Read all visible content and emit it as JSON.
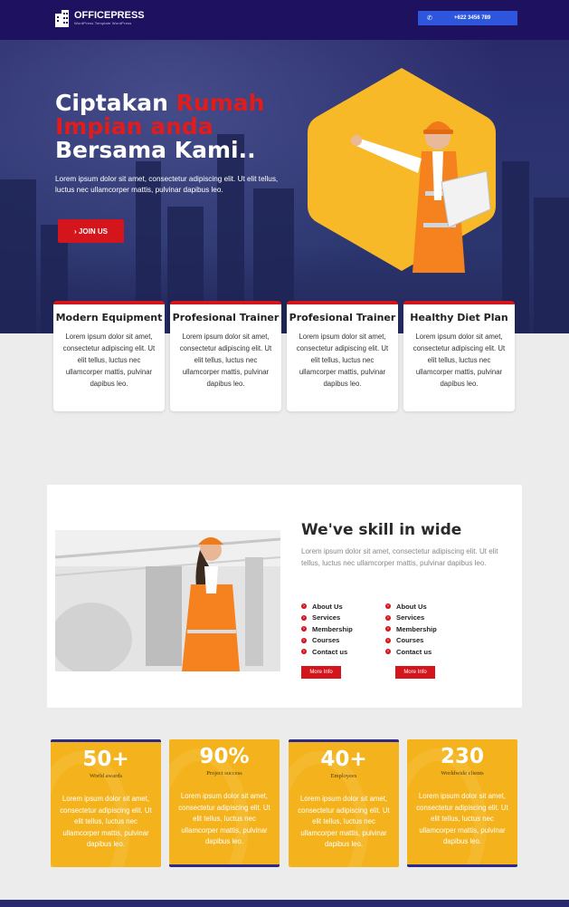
{
  "brand": {
    "name": "OFFICEPRESS",
    "tagline": "WordPress Template WordPress"
  },
  "header": {
    "phone": "+622 3456 789"
  },
  "hero": {
    "title_line1_a": "Ciptakan ",
    "title_line1_b": "Rumah",
    "title_line2": "Impian anda",
    "title_line3": "Bersama Kami..",
    "description": "Lorem ipsum dolor sit amet, consectetur adipiscing elit. Ut elit tellus, luctus nec ullamcorper mattis, pulvinar dapibus leo.",
    "button": "› JOIN US"
  },
  "features": [
    {
      "title": "Modern Equipment",
      "text": "Lorem ipsum dolor sit amet, consectetur adipiscing elit. Ut elit tellus, luctus nec ullamcorper mattis, pulvinar dapibus leo."
    },
    {
      "title": "Profesional Trainer",
      "text": "Lorem ipsum dolor sit amet, consectetur adipiscing elit. Ut elit tellus, luctus nec ullamcorper mattis, pulvinar dapibus leo."
    },
    {
      "title": "Profesional Trainer",
      "text": "Lorem ipsum dolor sit amet, consectetur adipiscing elit. Ut elit tellus, luctus nec ullamcorper mattis, pulvinar dapibus leo."
    },
    {
      "title": "Healthy Diet Plan",
      "text": "Lorem ipsum dolor sit amet, consectetur adipiscing elit. Ut elit tellus, luctus nec ullamcorper mattis, pulvinar dapibus leo."
    }
  ],
  "skill": {
    "title": "We've skill in wide",
    "description": "Lorem ipsum dolor sit amet, consectetur adipiscing elit. Ut elit tellus, luctus nec ullamcorper mattis, pulvinar dapibus leo.",
    "list_left": [
      "About Us",
      "Services",
      "Membership",
      "Courses",
      "Contact us"
    ],
    "list_right": [
      "About Us",
      "Services",
      "Membership",
      "Courses",
      "Contact us"
    ],
    "more_left": "More Info",
    "more_right": "More Info"
  },
  "stats": [
    {
      "value": "50+",
      "label": "World awards",
      "text": "Lorem ipsum dolor sit amet, consectetur adipiscing elit. Ut elit tellus, luctus nec ullamcorper mattis, pulvinar dapibus leo."
    },
    {
      "value": "90%",
      "label": "Project success",
      "text": "Lorem ipsum dolor sit amet, consectetur adipiscing elit. Ut elit tellus, luctus nec ullamcorper mattis, pulvinar dapibus leo."
    },
    {
      "value": "40+",
      "label": "Employees",
      "text": "Lorem ipsum dolor sit amet, consectetur adipiscing elit. Ut elit tellus, luctus nec ullamcorper mattis, pulvinar dapibus leo."
    },
    {
      "value": "230",
      "label": "Worldwide clients",
      "text": "Lorem ipsum dolor sit amet, consectetur adipiscing elit. Ut elit tellus, luctus nec ullamcorper mattis, pulvinar dapibus leo."
    }
  ],
  "colors": {
    "navy": "#1d1160",
    "red": "#d4151b",
    "yellow": "#f4b31c",
    "blue": "#2d56dd"
  }
}
